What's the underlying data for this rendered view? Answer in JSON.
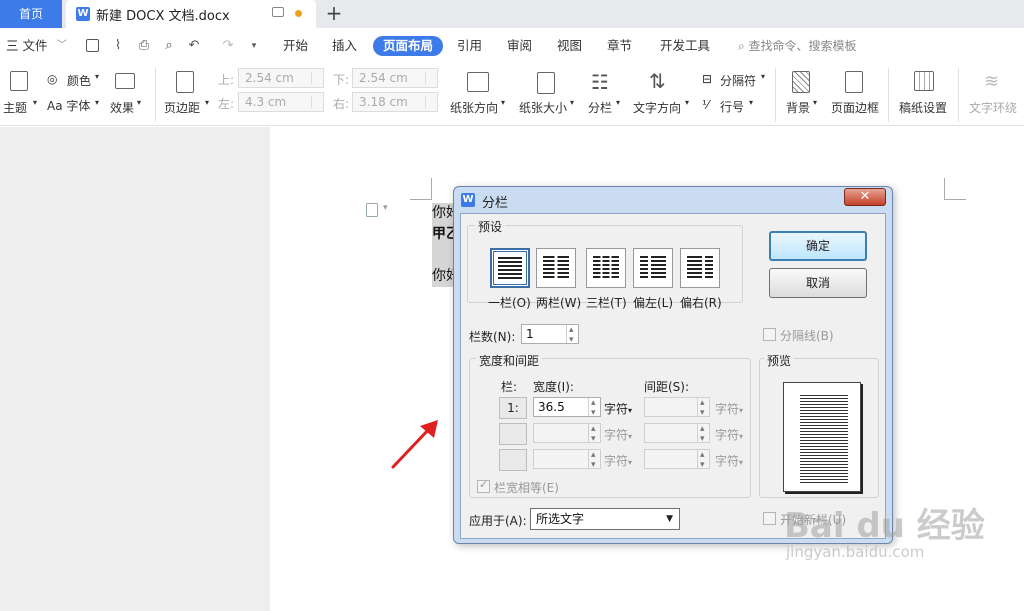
{
  "titlebar": {
    "home_tab": "首页",
    "doc_tab": "新建 DOCX 文档.docx",
    "logo_text": "W"
  },
  "menu": {
    "file": "三 文件",
    "items": [
      "开始",
      "插入",
      "页面布局",
      "引用",
      "审阅",
      "视图",
      "章节",
      "开发工具"
    ],
    "active": "页面布局",
    "search": "查找命令、搜索模板"
  },
  "ribbon": {
    "theme": "主题",
    "color": "颜色",
    "font": "Aa 字体",
    "effect": "效果",
    "margins": "页边距",
    "margin_top_label": "上:",
    "margin_top": "2.54 cm",
    "margin_bottom_label": "下:",
    "margin_bottom": "2.54 cm",
    "margin_left_label": "左:",
    "margin_left": "4.3 cm",
    "margin_right_label": "右:",
    "margin_right": "3.18 cm",
    "orientation": "纸张方向",
    "size": "纸张大小",
    "columns": "分栏",
    "text_direction": "文字方向",
    "separator": "分隔符",
    "line_number": "行号",
    "background": "背景",
    "page_border": "页面边框",
    "grid_paper": "稿纸设置",
    "text_wrap": "文字环绕"
  },
  "document": {
    "lines": [
      "你好",
      "甲乙",
      "",
      "你好"
    ]
  },
  "dialog": {
    "logo_text": "W",
    "title": "分栏",
    "close_label": "✕",
    "preset_group": "预设",
    "presets": [
      {
        "label": "一栏(O)",
        "selected": true
      },
      {
        "label": "两栏(W)",
        "selected": false
      },
      {
        "label": "三栏(T)",
        "selected": false
      },
      {
        "label": "偏左(L)",
        "selected": false
      },
      {
        "label": "偏右(R)",
        "selected": false
      }
    ],
    "ok": "确定",
    "cancel": "取消",
    "num_columns_label": "栏数(N):",
    "num_columns": "1",
    "separator_line": "分隔线(B)",
    "width_spacing_group": "宽度和间距",
    "col_header": "栏:",
    "width_header": "宽度(I):",
    "spacing_header": "间距(S):",
    "rows": [
      {
        "num": "1:",
        "width": "36.5",
        "spacing": ""
      },
      {
        "num": "",
        "width": "",
        "spacing": ""
      },
      {
        "num": "",
        "width": "",
        "spacing": ""
      }
    ],
    "unit": "字符",
    "equal_width": "栏宽相等(E)",
    "preview_group": "预览",
    "apply_label": "应用于(A):",
    "apply_value": "所选文字",
    "new_column": "开始新栏(U)"
  },
  "watermark": {
    "brand": "Bai du 经验",
    "url": "jingyan.baidu.com"
  },
  "colors": {
    "accent": "#3d7be8",
    "dialog_frame": "#c9dcf1",
    "arrow": "#e02020"
  }
}
